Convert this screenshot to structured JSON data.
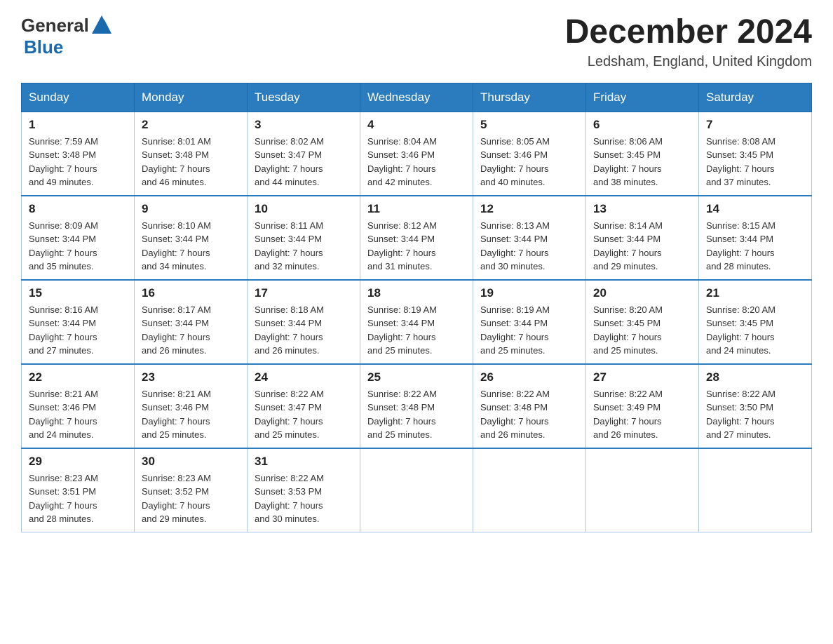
{
  "header": {
    "logo_general": "General",
    "logo_blue": "Blue",
    "month_title": "December 2024",
    "location": "Ledsham, England, United Kingdom"
  },
  "weekdays": [
    "Sunday",
    "Monday",
    "Tuesday",
    "Wednesday",
    "Thursday",
    "Friday",
    "Saturday"
  ],
  "weeks": [
    [
      {
        "day": "1",
        "sunrise": "Sunrise: 7:59 AM",
        "sunset": "Sunset: 3:48 PM",
        "daylight": "Daylight: 7 hours",
        "minutes": "and 49 minutes."
      },
      {
        "day": "2",
        "sunrise": "Sunrise: 8:01 AM",
        "sunset": "Sunset: 3:48 PM",
        "daylight": "Daylight: 7 hours",
        "minutes": "and 46 minutes."
      },
      {
        "day": "3",
        "sunrise": "Sunrise: 8:02 AM",
        "sunset": "Sunset: 3:47 PM",
        "daylight": "Daylight: 7 hours",
        "minutes": "and 44 minutes."
      },
      {
        "day": "4",
        "sunrise": "Sunrise: 8:04 AM",
        "sunset": "Sunset: 3:46 PM",
        "daylight": "Daylight: 7 hours",
        "minutes": "and 42 minutes."
      },
      {
        "day": "5",
        "sunrise": "Sunrise: 8:05 AM",
        "sunset": "Sunset: 3:46 PM",
        "daylight": "Daylight: 7 hours",
        "minutes": "and 40 minutes."
      },
      {
        "day": "6",
        "sunrise": "Sunrise: 8:06 AM",
        "sunset": "Sunset: 3:45 PM",
        "daylight": "Daylight: 7 hours",
        "minutes": "and 38 minutes."
      },
      {
        "day": "7",
        "sunrise": "Sunrise: 8:08 AM",
        "sunset": "Sunset: 3:45 PM",
        "daylight": "Daylight: 7 hours",
        "minutes": "and 37 minutes."
      }
    ],
    [
      {
        "day": "8",
        "sunrise": "Sunrise: 8:09 AM",
        "sunset": "Sunset: 3:44 PM",
        "daylight": "Daylight: 7 hours",
        "minutes": "and 35 minutes."
      },
      {
        "day": "9",
        "sunrise": "Sunrise: 8:10 AM",
        "sunset": "Sunset: 3:44 PM",
        "daylight": "Daylight: 7 hours",
        "minutes": "and 34 minutes."
      },
      {
        "day": "10",
        "sunrise": "Sunrise: 8:11 AM",
        "sunset": "Sunset: 3:44 PM",
        "daylight": "Daylight: 7 hours",
        "minutes": "and 32 minutes."
      },
      {
        "day": "11",
        "sunrise": "Sunrise: 8:12 AM",
        "sunset": "Sunset: 3:44 PM",
        "daylight": "Daylight: 7 hours",
        "minutes": "and 31 minutes."
      },
      {
        "day": "12",
        "sunrise": "Sunrise: 8:13 AM",
        "sunset": "Sunset: 3:44 PM",
        "daylight": "Daylight: 7 hours",
        "minutes": "and 30 minutes."
      },
      {
        "day": "13",
        "sunrise": "Sunrise: 8:14 AM",
        "sunset": "Sunset: 3:44 PM",
        "daylight": "Daylight: 7 hours",
        "minutes": "and 29 minutes."
      },
      {
        "day": "14",
        "sunrise": "Sunrise: 8:15 AM",
        "sunset": "Sunset: 3:44 PM",
        "daylight": "Daylight: 7 hours",
        "minutes": "and 28 minutes."
      }
    ],
    [
      {
        "day": "15",
        "sunrise": "Sunrise: 8:16 AM",
        "sunset": "Sunset: 3:44 PM",
        "daylight": "Daylight: 7 hours",
        "minutes": "and 27 minutes."
      },
      {
        "day": "16",
        "sunrise": "Sunrise: 8:17 AM",
        "sunset": "Sunset: 3:44 PM",
        "daylight": "Daylight: 7 hours",
        "minutes": "and 26 minutes."
      },
      {
        "day": "17",
        "sunrise": "Sunrise: 8:18 AM",
        "sunset": "Sunset: 3:44 PM",
        "daylight": "Daylight: 7 hours",
        "minutes": "and 26 minutes."
      },
      {
        "day": "18",
        "sunrise": "Sunrise: 8:19 AM",
        "sunset": "Sunset: 3:44 PM",
        "daylight": "Daylight: 7 hours",
        "minutes": "and 25 minutes."
      },
      {
        "day": "19",
        "sunrise": "Sunrise: 8:19 AM",
        "sunset": "Sunset: 3:44 PM",
        "daylight": "Daylight: 7 hours",
        "minutes": "and 25 minutes."
      },
      {
        "day": "20",
        "sunrise": "Sunrise: 8:20 AM",
        "sunset": "Sunset: 3:45 PM",
        "daylight": "Daylight: 7 hours",
        "minutes": "and 25 minutes."
      },
      {
        "day": "21",
        "sunrise": "Sunrise: 8:20 AM",
        "sunset": "Sunset: 3:45 PM",
        "daylight": "Daylight: 7 hours",
        "minutes": "and 24 minutes."
      }
    ],
    [
      {
        "day": "22",
        "sunrise": "Sunrise: 8:21 AM",
        "sunset": "Sunset: 3:46 PM",
        "daylight": "Daylight: 7 hours",
        "minutes": "and 24 minutes."
      },
      {
        "day": "23",
        "sunrise": "Sunrise: 8:21 AM",
        "sunset": "Sunset: 3:46 PM",
        "daylight": "Daylight: 7 hours",
        "minutes": "and 25 minutes."
      },
      {
        "day": "24",
        "sunrise": "Sunrise: 8:22 AM",
        "sunset": "Sunset: 3:47 PM",
        "daylight": "Daylight: 7 hours",
        "minutes": "and 25 minutes."
      },
      {
        "day": "25",
        "sunrise": "Sunrise: 8:22 AM",
        "sunset": "Sunset: 3:48 PM",
        "daylight": "Daylight: 7 hours",
        "minutes": "and 25 minutes."
      },
      {
        "day": "26",
        "sunrise": "Sunrise: 8:22 AM",
        "sunset": "Sunset: 3:48 PM",
        "daylight": "Daylight: 7 hours",
        "minutes": "and 26 minutes."
      },
      {
        "day": "27",
        "sunrise": "Sunrise: 8:22 AM",
        "sunset": "Sunset: 3:49 PM",
        "daylight": "Daylight: 7 hours",
        "minutes": "and 26 minutes."
      },
      {
        "day": "28",
        "sunrise": "Sunrise: 8:22 AM",
        "sunset": "Sunset: 3:50 PM",
        "daylight": "Daylight: 7 hours",
        "minutes": "and 27 minutes."
      }
    ],
    [
      {
        "day": "29",
        "sunrise": "Sunrise: 8:23 AM",
        "sunset": "Sunset: 3:51 PM",
        "daylight": "Daylight: 7 hours",
        "minutes": "and 28 minutes."
      },
      {
        "day": "30",
        "sunrise": "Sunrise: 8:23 AM",
        "sunset": "Sunset: 3:52 PM",
        "daylight": "Daylight: 7 hours",
        "minutes": "and 29 minutes."
      },
      {
        "day": "31",
        "sunrise": "Sunrise: 8:22 AM",
        "sunset": "Sunset: 3:53 PM",
        "daylight": "Daylight: 7 hours",
        "minutes": "and 30 minutes."
      },
      null,
      null,
      null,
      null
    ]
  ]
}
